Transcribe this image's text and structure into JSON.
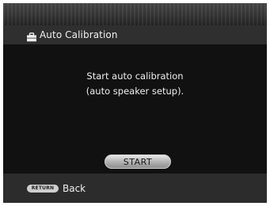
{
  "header": {
    "icon": "toolbox-icon",
    "title": "Auto Calibration"
  },
  "main": {
    "message_line1": "Start auto calibration",
    "message_line2": "(auto speaker setup).",
    "start_label": "START"
  },
  "footer": {
    "return_key_label": "RETURN",
    "back_label": "Back"
  }
}
